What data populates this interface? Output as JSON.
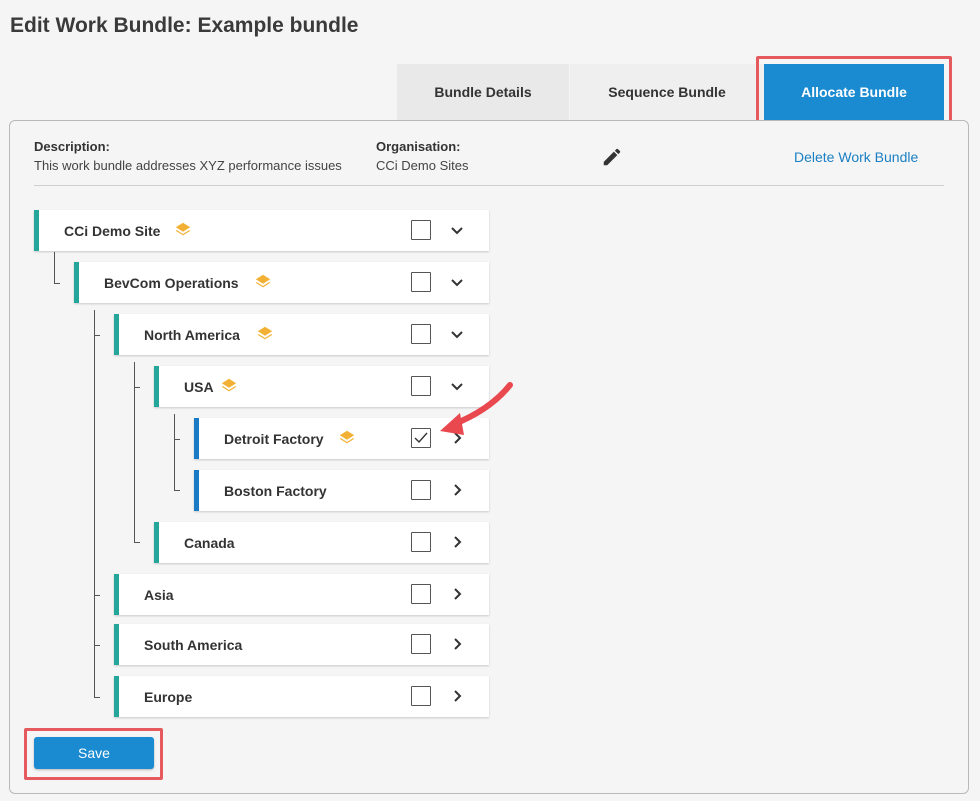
{
  "page": {
    "title": "Edit Work Bundle: Example bundle"
  },
  "tabs": [
    {
      "label": "Bundle Details",
      "active": false
    },
    {
      "label": "Sequence Bundle",
      "active": false
    },
    {
      "label": "Allocate Bundle",
      "active": true
    }
  ],
  "details": {
    "description_label": "Description:",
    "description_value": "This work bundle addresses XYZ performance issues",
    "organisation_label": "Organisation:",
    "organisation_value": "CCi Demo Sites",
    "edit_icon": "pencil-icon",
    "delete_label": "Delete Work Bundle"
  },
  "tree": [
    {
      "label": "CCi Demo Site",
      "level": 0,
      "has_layers": true,
      "checked": false,
      "chevron": "down",
      "accent": "#25a69a"
    },
    {
      "label": "BevCom Operations",
      "level": 1,
      "has_layers": true,
      "checked": false,
      "chevron": "down",
      "accent": "#25a69a"
    },
    {
      "label": "North America",
      "level": 2,
      "has_layers": true,
      "checked": false,
      "chevron": "down",
      "accent": "#25a69a"
    },
    {
      "label": "USA",
      "level": 3,
      "has_layers": true,
      "checked": false,
      "chevron": "down",
      "accent": "#25a69a"
    },
    {
      "label": "Detroit Factory",
      "level": 4,
      "has_layers": true,
      "checked": true,
      "chevron": "right",
      "accent": "#1a7ac4"
    },
    {
      "label": "Boston Factory",
      "level": 4,
      "has_layers": false,
      "checked": false,
      "chevron": "right",
      "accent": "#1a7ac4"
    },
    {
      "label": "Canada",
      "level": 3,
      "has_layers": false,
      "checked": false,
      "chevron": "right",
      "accent": "#25a69a"
    },
    {
      "label": "Asia",
      "level": 2,
      "has_layers": false,
      "checked": false,
      "chevron": "right",
      "accent": "#25a69a"
    },
    {
      "label": "South America",
      "level": 2,
      "has_layers": false,
      "checked": false,
      "chevron": "right",
      "accent": "#25a69a"
    },
    {
      "label": "Europe",
      "level": 2,
      "has_layers": false,
      "checked": false,
      "chevron": "right",
      "accent": "#25a69a"
    }
  ],
  "actions": {
    "save_label": "Save"
  },
  "colors": {
    "primary": "#1a8ad1",
    "teal_accent": "#25a69a",
    "blue_accent": "#1a7ac4",
    "highlight": "#e45a5e",
    "layers_icon": "#f2b134"
  }
}
